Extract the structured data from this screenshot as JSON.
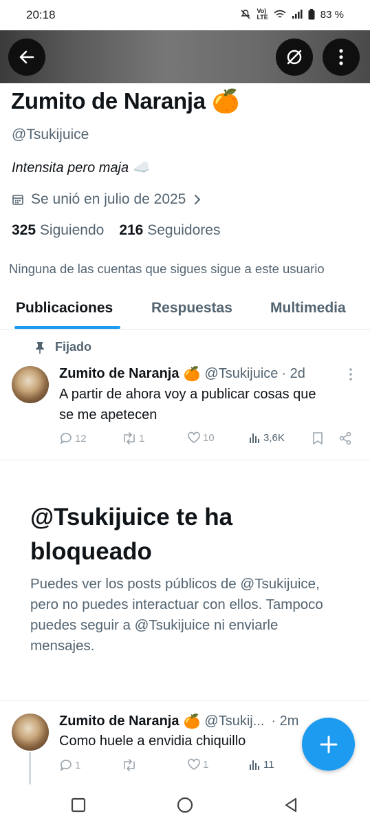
{
  "status_bar": {
    "time": "20:18",
    "battery": "83 %"
  },
  "profile": {
    "name": "Zumito de Naranja",
    "name_emoji": "🍊",
    "handle": "@Tsukijuice",
    "bio": "Intensita pero maja ☁️",
    "joined": "Se unió en julio de 2025",
    "following_count": "325",
    "following_label": "Siguiendo",
    "followers_count": "216",
    "followers_label": "Seguidores",
    "mutuals": "Ninguna de las cuentas que sigues sigue a este usuario"
  },
  "tabs": [
    {
      "label": "Publicaciones",
      "active": true
    },
    {
      "label": "Respuestas",
      "active": false
    },
    {
      "label": "Multimedia",
      "active": false
    }
  ],
  "pinned_tweet": {
    "pinned_label": "Fijado",
    "author": "Zumito de Naranja",
    "emoji": "🍊",
    "handle": "@Tsukijuice",
    "time": "· 2d",
    "text_line1": "A partir de ahora voy a publicar cosas que",
    "text_line2": "se me apetecen",
    "replies": "12",
    "reposts": "1",
    "likes": "10",
    "views": "3,6K"
  },
  "blocked": {
    "title": "@Tsukijuice te ha bloqueado",
    "body": "Puedes ver los posts públicos de @Tsukijuice, pero no puedes interactuar con ellos. Tampoco puedes seguir a @Tsukijuice ni enviarle mensajes."
  },
  "second_tweet": {
    "author": "Zumito de Naranja",
    "emoji": "🍊",
    "handle": "@Tsukij...",
    "time": "· 2m",
    "text": "Como huele a envidia chiquillo",
    "replies": "1",
    "reposts": "",
    "likes": "1",
    "views": "11"
  },
  "colors": {
    "accent": "#1d9bf0",
    "text": "#0f1419",
    "secondary": "#536471"
  },
  "icons": [
    "back-arrow-icon",
    "no-mute-icon",
    "more-vertical-icon",
    "calendar-icon",
    "chevron-right-icon",
    "pin-icon",
    "reply-icon",
    "repost-icon",
    "like-icon",
    "views-icon",
    "bookmark-icon",
    "share-icon",
    "plus-icon"
  ]
}
